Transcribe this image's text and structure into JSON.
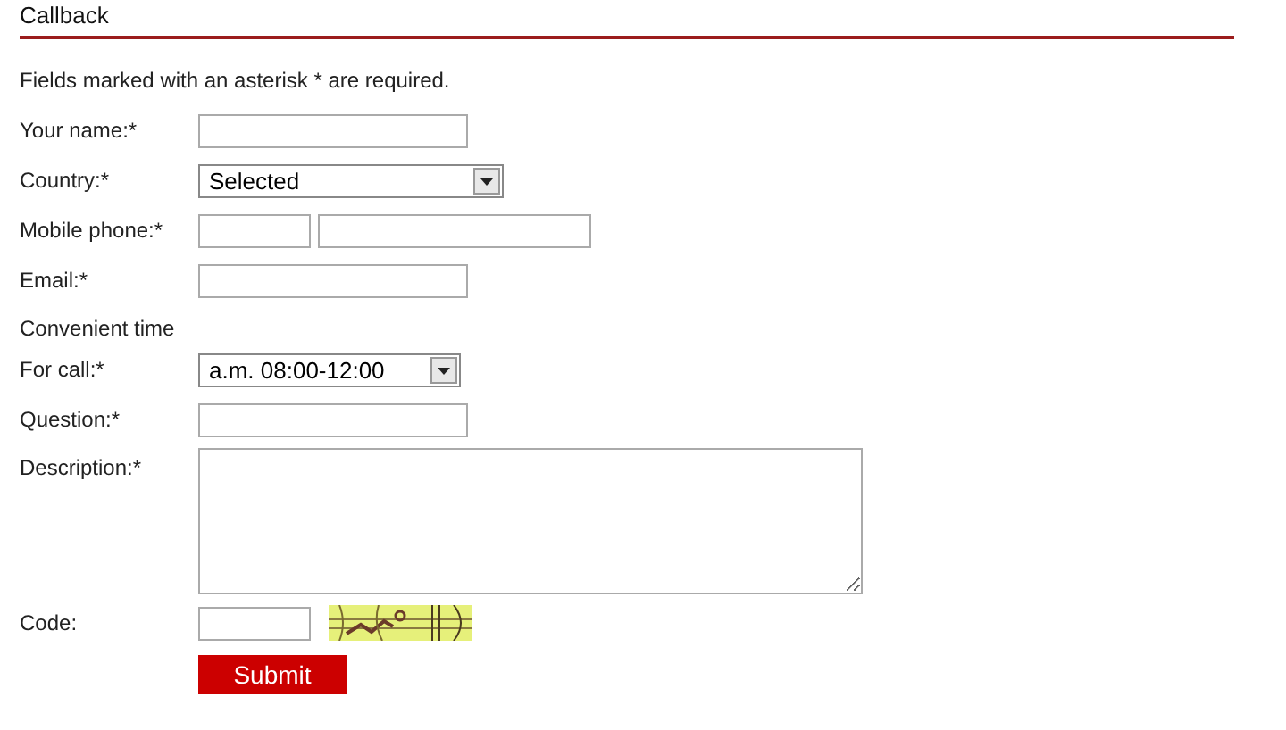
{
  "title": "Callback",
  "note": "Fields marked with an asterisk * are required.",
  "rows": [
    {
      "kind": "text",
      "label": "Your name:*"
    },
    {
      "kind": "select",
      "label": "Country:*",
      "value": "Selected",
      "wide": true
    },
    {
      "kind": "phone",
      "label": "Mobile phone:*"
    },
    {
      "kind": "text",
      "label": "Email:*"
    },
    {
      "kind": "heading",
      "label": "Convenient time"
    },
    {
      "kind": "select",
      "label": "For call:*",
      "value": "a.m. 08:00-12:00",
      "wide": false
    },
    {
      "kind": "text",
      "label": "Question:*"
    },
    {
      "kind": "textarea",
      "label": "Description:*"
    },
    {
      "kind": "captcha",
      "label": "Code:"
    }
  ],
  "submit": "Submit"
}
